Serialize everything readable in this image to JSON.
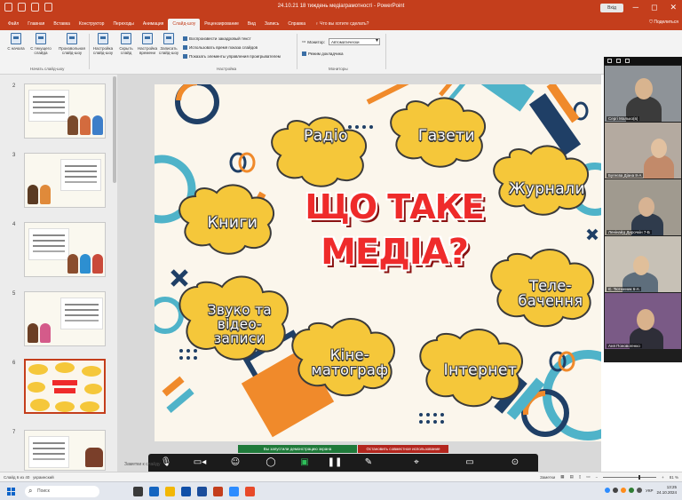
{
  "window": {
    "title": "24.10.21 18 тиждень медіаграмотності - PowerPoint",
    "search_button": "Вхід",
    "controls": [
      "─",
      "◻",
      "✕"
    ]
  },
  "menu": {
    "tabs": [
      "Файл",
      "Главная",
      "Вставка",
      "Конструктор",
      "Переходы",
      "Анимация",
      "Слайд-шоу",
      "Рецензирование",
      "Вид",
      "Запись",
      "Справка"
    ],
    "active_tab": "Слайд-шоу",
    "search": "Что вы хотите сделать?",
    "share": "Поделиться"
  },
  "ribbon": {
    "buttons": [
      {
        "label": "С начала",
        "icon": "play-from-start-icon"
      },
      {
        "label": "С текущего слайда",
        "icon": "play-current-icon"
      },
      {
        "label": "Произвольная слайд-шоу",
        "icon": "custom-show-icon"
      },
      {
        "label": "Настройка слайд-шоу",
        "icon": "setup-show-icon"
      },
      {
        "label": "Скрыть слайд",
        "icon": "hide-slide-icon"
      },
      {
        "label": "Настройка времени",
        "icon": "rehearse-timings-icon"
      },
      {
        "label": "Записать слайд-шоу",
        "icon": "record-show-icon"
      }
    ],
    "group_start": "Начать слайд-шоу",
    "group_setup": "Настройка",
    "group_monitors": "Мониторы",
    "options": [
      {
        "label": "Воспроизвести закадровый текст",
        "checked": true
      },
      {
        "label": "Использовать время показа слайдов",
        "checked": true
      },
      {
        "label": "Показать элементы управления проигрывателем",
        "checked": true
      }
    ],
    "monitor_label": "Монитор:",
    "monitor_value": "Автоматически",
    "presenter_view": "Режим докладчика"
  },
  "thumbnails": {
    "numbers": [
      "2",
      "3",
      "4",
      "5",
      "6",
      "7"
    ],
    "selected": "6"
  },
  "slide": {
    "title_line1": "ЩО ТАКЕ",
    "title_line2": "МЕДІА?",
    "clouds": [
      {
        "text": "Радіо"
      },
      {
        "text": "Газети"
      },
      {
        "text": "Журнали"
      },
      {
        "text": "Книги"
      },
      {
        "text": "Теле-\nбачення"
      },
      {
        "text": "Звуко та\nвідео-\nзаписи"
      },
      {
        "text": "Кіне-\nматограф"
      },
      {
        "text": "Інтернет"
      }
    ],
    "colors": {
      "cloud": "#f5c73a",
      "cloud_edge": "#d6a61d",
      "title": "#ef2b2b",
      "bg": "#fbf6ec"
    }
  },
  "participants": [
    {
      "name": "Сергі Малько(в)"
    },
    {
      "name": "Бугеєва Діана 8-А"
    },
    {
      "name": "Ленінайд Дирочкін 7-Б"
    },
    {
      "name": "Є. Тютюнник 6-А"
    },
    {
      "name": "Аня Поновоrенко"
    }
  ],
  "banners": {
    "green": "Вы запустили демонстрацию экрана",
    "red": "Остановить совместное использование"
  },
  "zoom_toolbar": [
    {
      "label": "Звук",
      "icon": "microphone-icon"
    },
    {
      "label": "Видео",
      "icon": "video-camera-icon"
    },
    {
      "label": "Участники",
      "icon": "participants-icon"
    },
    {
      "label": "Чат",
      "icon": "chat-icon"
    },
    {
      "label": "Поделиться",
      "icon": "share-screen-icon"
    },
    {
      "label": "Пауза",
      "icon": "pause-icon"
    },
    {
      "label": "Комментировать",
      "icon": "annotate-icon"
    },
    {
      "label": "Дистанционное управление",
      "icon": "remote-control-icon"
    },
    {
      "label": "Показать конференцию",
      "icon": "show-meeting-icon"
    },
    {
      "label": "Дополнительно",
      "icon": "more-icon"
    }
  ],
  "statusbar": {
    "slide_info": "Слайд 6 из 40",
    "language": "украинский",
    "notes": "Заметки к слайду",
    "notes_btn": "Заметки",
    "zoom": "81 %"
  },
  "taskbar": {
    "search": "Поиск",
    "time": "13:25",
    "date": "24.10.2024",
    "lang": "УКР"
  }
}
